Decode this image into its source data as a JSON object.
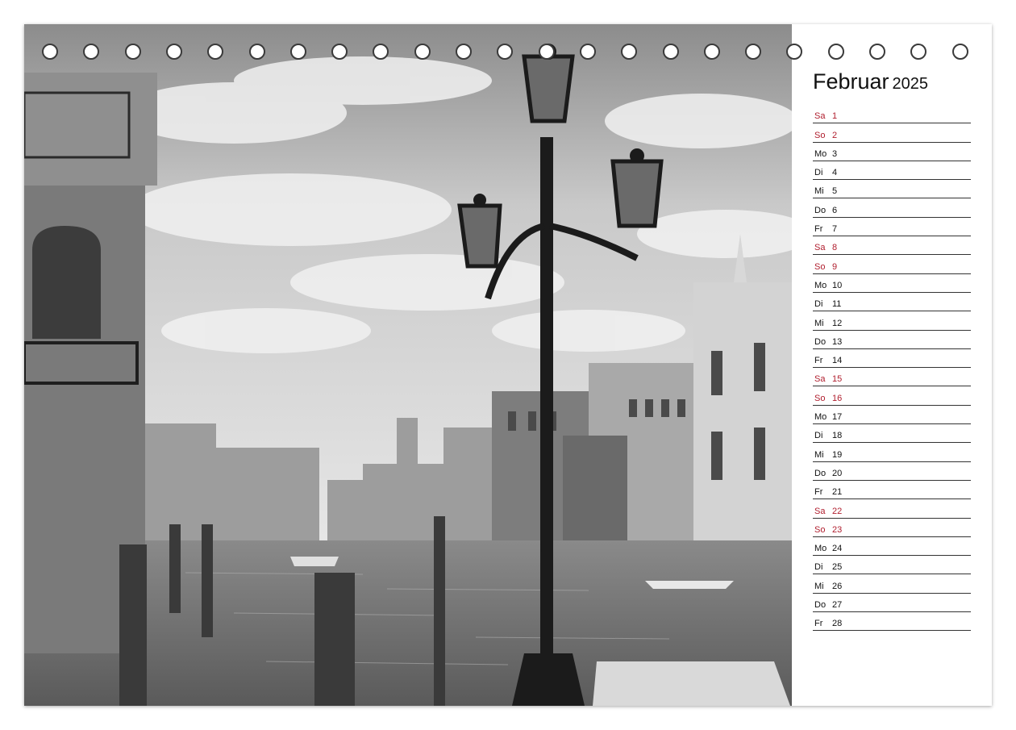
{
  "calendar": {
    "month": "Februar",
    "year": "2025",
    "days": [
      {
        "wd": "Sa",
        "d": "1",
        "weekend": true
      },
      {
        "wd": "So",
        "d": "2",
        "weekend": true
      },
      {
        "wd": "Mo",
        "d": "3",
        "weekend": false
      },
      {
        "wd": "Di",
        "d": "4",
        "weekend": false
      },
      {
        "wd": "Mi",
        "d": "5",
        "weekend": false
      },
      {
        "wd": "Do",
        "d": "6",
        "weekend": false
      },
      {
        "wd": "Fr",
        "d": "7",
        "weekend": false
      },
      {
        "wd": "Sa",
        "d": "8",
        "weekend": true
      },
      {
        "wd": "So",
        "d": "9",
        "weekend": true
      },
      {
        "wd": "Mo",
        "d": "10",
        "weekend": false
      },
      {
        "wd": "Di",
        "d": "11",
        "weekend": false
      },
      {
        "wd": "Mi",
        "d": "12",
        "weekend": false
      },
      {
        "wd": "Do",
        "d": "13",
        "weekend": false
      },
      {
        "wd": "Fr",
        "d": "14",
        "weekend": false
      },
      {
        "wd": "Sa",
        "d": "15",
        "weekend": true
      },
      {
        "wd": "So",
        "d": "16",
        "weekend": true
      },
      {
        "wd": "Mo",
        "d": "17",
        "weekend": false
      },
      {
        "wd": "Di",
        "d": "18",
        "weekend": false
      },
      {
        "wd": "Mi",
        "d": "19",
        "weekend": false
      },
      {
        "wd": "Do",
        "d": "20",
        "weekend": false
      },
      {
        "wd": "Fr",
        "d": "21",
        "weekend": false
      },
      {
        "wd": "Sa",
        "d": "22",
        "weekend": true
      },
      {
        "wd": "So",
        "d": "23",
        "weekend": true
      },
      {
        "wd": "Mo",
        "d": "24",
        "weekend": false
      },
      {
        "wd": "Di",
        "d": "25",
        "weekend": false
      },
      {
        "wd": "Mi",
        "d": "26",
        "weekend": false
      },
      {
        "wd": "Do",
        "d": "27",
        "weekend": false
      },
      {
        "wd": "Fr",
        "d": "28",
        "weekend": false
      }
    ]
  },
  "photo": {
    "subject": "venice-grand-canal-street-lamp",
    "style": "black-and-white"
  },
  "colors": {
    "weekend": "#b01e2e",
    "weekday": "#111111",
    "rule": "#333333"
  },
  "binding": {
    "ring_count": 23,
    "icon": "spiral-binding-ring"
  }
}
